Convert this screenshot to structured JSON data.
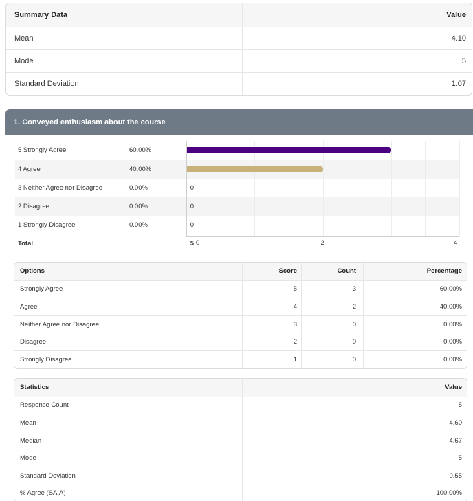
{
  "summary": {
    "header": {
      "label": "Summary Data",
      "value": "Value"
    },
    "rows": [
      {
        "label": "Mean",
        "value": "4.10"
      },
      {
        "label": "Mode",
        "value": "5"
      },
      {
        "label": "Standard Deviation",
        "value": "1.07"
      }
    ]
  },
  "question": {
    "title": "1. Conveyed enthusiasm about the course"
  },
  "chart_data": {
    "type": "bar",
    "orientation": "horizontal",
    "categories": [
      "5 Strongly Agree",
      "4 Agree",
      "3 Neither Agree nor Disagree",
      "2 Disagree",
      "1 Strongly Disagree"
    ],
    "percentages": [
      "60.00%",
      "40.00%",
      "0.00%",
      "0.00%",
      "0.00%"
    ],
    "values": [
      3,
      2,
      0,
      0,
      0
    ],
    "colors": [
      "#4b0082",
      "#c8b27a",
      "#cccccc",
      "#cccccc",
      "#cccccc"
    ],
    "total_label": "Total",
    "total_value": "5",
    "xlim": [
      0,
      4
    ],
    "xticks": [
      "0",
      "2",
      "4"
    ],
    "grid": true
  },
  "options_table": {
    "headers": [
      "Options",
      "Score",
      "Count",
      "Percentage"
    ],
    "rows": [
      [
        "Strongly Agree",
        "5",
        "3",
        "60.00%"
      ],
      [
        "Agree",
        "4",
        "2",
        "40.00%"
      ],
      [
        "Neither Agree nor Disagree",
        "3",
        "0",
        "0.00%"
      ],
      [
        "Disagree",
        "2",
        "0",
        "0.00%"
      ],
      [
        "Strongly Disagree",
        "1",
        "0",
        "0.00%"
      ]
    ]
  },
  "statistics_table": {
    "headers": [
      "Statistics",
      "Value"
    ],
    "rows": [
      [
        "Response Count",
        "5"
      ],
      [
        "Mean",
        "4.60"
      ],
      [
        "Median",
        "4.67"
      ],
      [
        "Mode",
        "5"
      ],
      [
        "Standard Deviation",
        "0.55"
      ],
      [
        "% Agree (SA,A)",
        "100.00%"
      ]
    ]
  }
}
